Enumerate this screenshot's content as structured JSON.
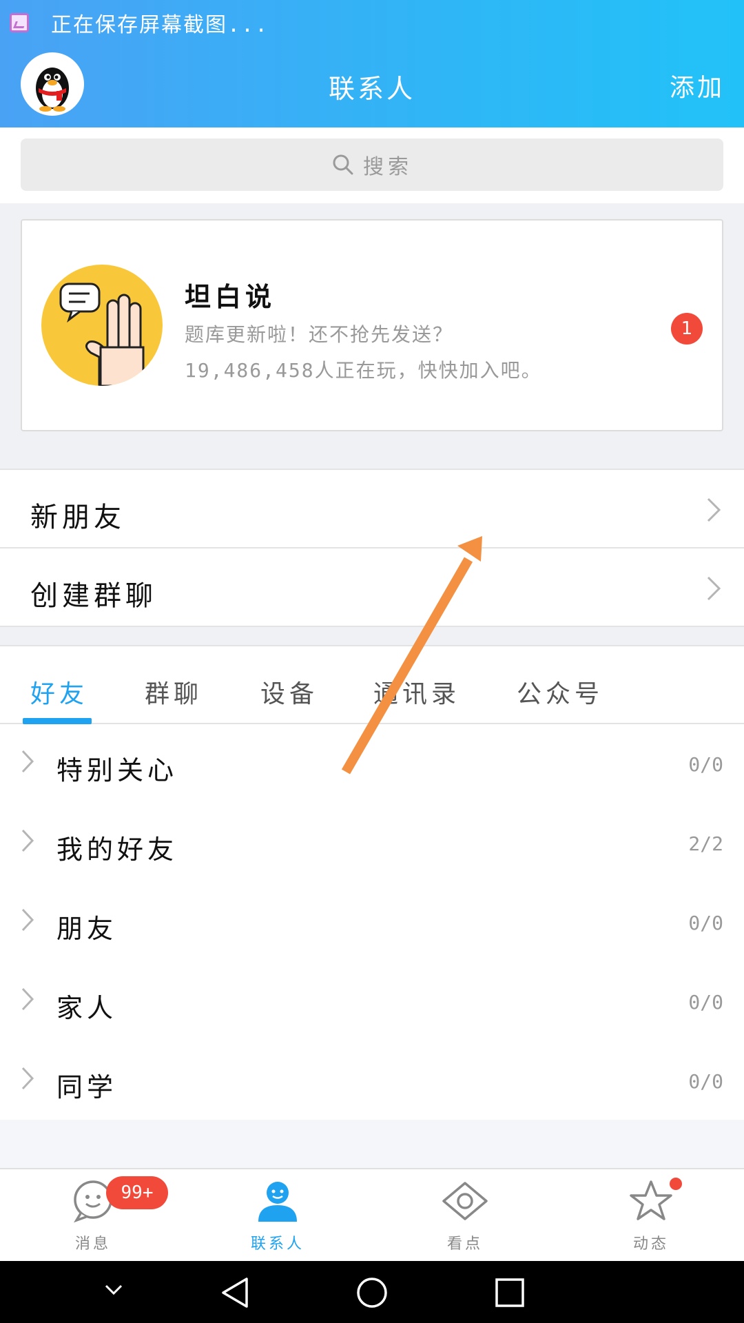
{
  "status": {
    "text": "正在保存屏幕截图..."
  },
  "header": {
    "title": "联系人",
    "add_label": "添加"
  },
  "search": {
    "placeholder": "搜索"
  },
  "promo": {
    "title": "坦白说",
    "line1": "题库更新啦！还不抢先发送？",
    "line2": "19,486,458人正在玩，快快加入吧。",
    "badge": "1"
  },
  "menu": {
    "items": [
      {
        "label": "新朋友"
      },
      {
        "label": "创建群聊"
      }
    ]
  },
  "tabs": [
    {
      "label": "好友",
      "active": true
    },
    {
      "label": "群聊"
    },
    {
      "label": "设备"
    },
    {
      "label": "通讯录"
    },
    {
      "label": "公众号"
    }
  ],
  "groups": [
    {
      "name": "特别关心",
      "count": "0/0"
    },
    {
      "name": "我的好友",
      "count": "2/2"
    },
    {
      "name": "朋友",
      "count": "0/0"
    },
    {
      "name": "家人",
      "count": "0/0"
    },
    {
      "name": "同学",
      "count": "0/0"
    }
  ],
  "bottom_nav": {
    "items": [
      {
        "label": "消息",
        "icon": "message-icon"
      },
      {
        "label": "联系人",
        "icon": "contacts-icon",
        "active": true
      },
      {
        "label": "看点",
        "icon": "eye-icon"
      },
      {
        "label": "动态",
        "icon": "star-icon"
      }
    ],
    "message_badge": "99+"
  },
  "colors": {
    "header": "#2fb6f6",
    "accent": "#1fa3f0",
    "badge": "#f24a3a",
    "arrow": "#f39041"
  }
}
